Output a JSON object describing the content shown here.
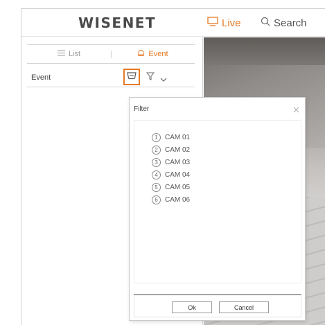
{
  "header": {
    "logo": "WISENET",
    "nav": {
      "live_label": "Live",
      "search_label": "Search"
    }
  },
  "left_panel": {
    "tabs": [
      {
        "label": "List",
        "icon": "list-icon",
        "active": false
      },
      {
        "label": "Event",
        "icon": "event-icon",
        "active": true
      }
    ],
    "event_row": {
      "label": "Event"
    }
  },
  "filter_popup": {
    "title": "Filter",
    "cameras": [
      {
        "num": "1",
        "label": "CAM 01"
      },
      {
        "num": "2",
        "label": "CAM 02"
      },
      {
        "num": "3",
        "label": "CAM 03"
      },
      {
        "num": "4",
        "label": "CAM 04"
      },
      {
        "num": "5",
        "label": "CAM 05"
      },
      {
        "num": "6",
        "label": "CAM 06"
      }
    ],
    "ok_label": "Ok",
    "cancel_label": "Cancel"
  },
  "colors": {
    "accent": "#e57924",
    "border": "#d4d4d4",
    "text": "#444444"
  }
}
